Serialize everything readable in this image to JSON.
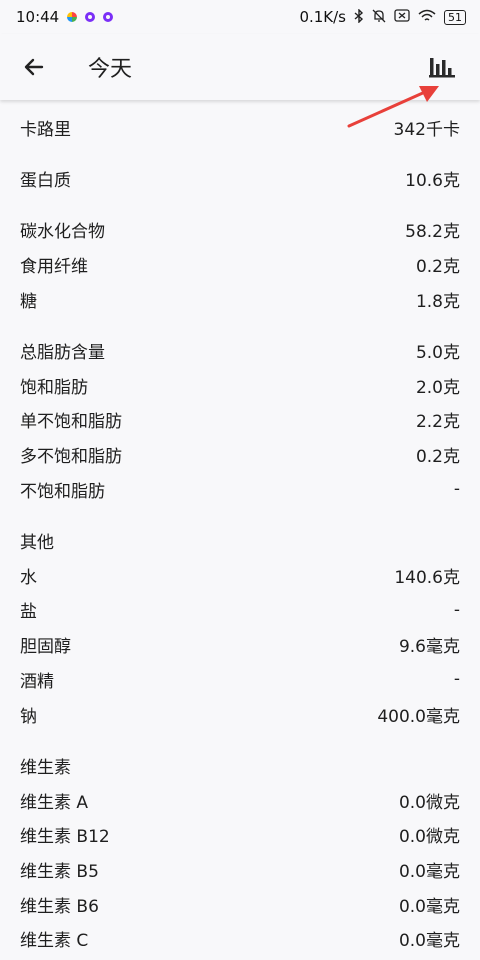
{
  "status": {
    "time": "10:44",
    "net_speed": "0.1K/s",
    "battery": "51"
  },
  "header": {
    "title": "今天"
  },
  "rows": [
    {
      "label": "卡路里",
      "value": "342千卡"
    },
    {
      "label": "蛋白质",
      "value": "10.6克"
    },
    {
      "label": "碳水化合物",
      "value": "58.2克"
    },
    {
      "label": "食用纤维",
      "value": "0.2克"
    },
    {
      "label": "糖",
      "value": "1.8克"
    },
    {
      "label": "总脂肪含量",
      "value": "5.0克"
    },
    {
      "label": "饱和脂肪",
      "value": "2.0克"
    },
    {
      "label": "单不饱和脂肪",
      "value": "2.2克"
    },
    {
      "label": "多不饱和脂肪",
      "value": "0.2克"
    },
    {
      "label": "不饱和脂肪",
      "value": "-"
    },
    {
      "label": "水",
      "value": "140.6克"
    },
    {
      "label": "盐",
      "value": "-"
    },
    {
      "label": "胆固醇",
      "value": "9.6毫克"
    },
    {
      "label": "酒精",
      "value": "-"
    },
    {
      "label": "钠",
      "value": "400.0毫克"
    },
    {
      "label": "维生素 A",
      "value": "0.0微克"
    },
    {
      "label": "维生素 B12",
      "value": "0.0微克"
    },
    {
      "label": "维生素 B5",
      "value": "0.0毫克"
    },
    {
      "label": "维生素 B6",
      "value": "0.0毫克"
    },
    {
      "label": "维生素 C",
      "value": "0.0毫克"
    }
  ],
  "sections": {
    "other": "其他",
    "vitamins": "维生素"
  },
  "colors": {
    "background": "#f8f8fa",
    "arrow": "#e8403a"
  }
}
